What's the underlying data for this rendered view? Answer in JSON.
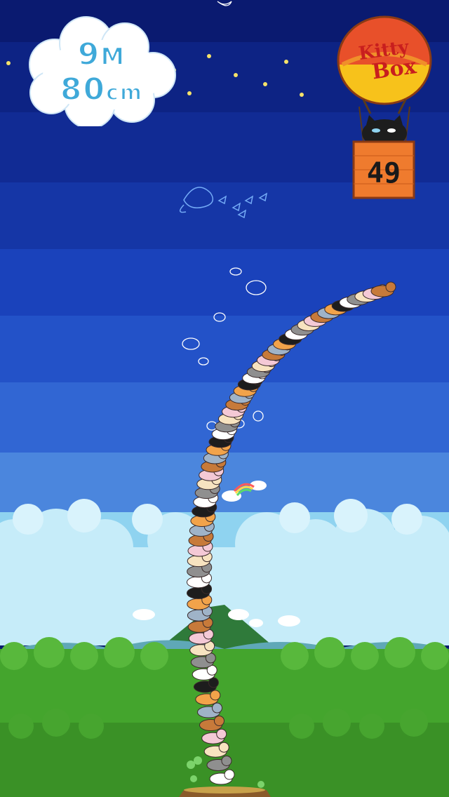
{
  "game": {
    "height_meters": "9",
    "meters_unit": "M",
    "height_cm": "80",
    "cm_unit": "cm",
    "balloon_title_line1": "Kitty",
    "balloon_title_line2": "Box",
    "cats_remaining": "49"
  },
  "colors": {
    "sky_top": "#0b1f78",
    "sky_mid": "#1f4fd0",
    "sky_low": "#6aa6e8",
    "horizon": "#bfe6f7",
    "grass": "#3f9b2a",
    "score_text": "#3fa9d9",
    "balloon_red": "#e8502a",
    "balloon_yellow": "#f7c21b",
    "basket": "#ef7b2e"
  },
  "icons": [
    "cloud-icon",
    "hot-air-balloon-icon",
    "black-cat-icon",
    "star-icon",
    "rainbow-icon",
    "mountain-icon",
    "tree-stump-icon"
  ]
}
